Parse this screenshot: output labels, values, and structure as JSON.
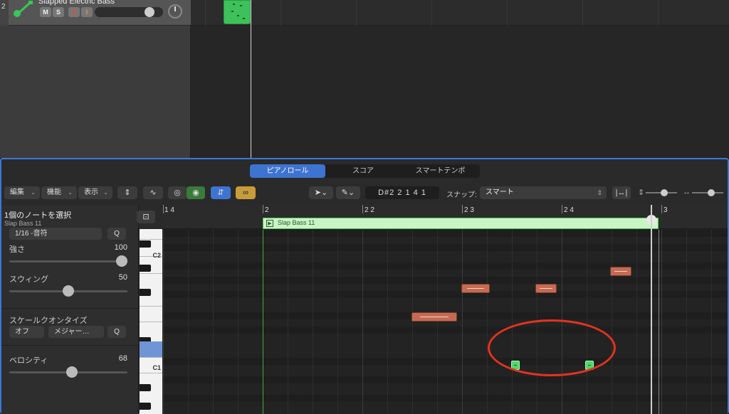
{
  "track": {
    "number": "2",
    "name": "Slapped Electric Bass",
    "buttons": [
      "M",
      "S",
      "R",
      "I"
    ]
  },
  "editor": {
    "tabs": [
      "ピアノロール",
      "スコア",
      "スマートテンポ"
    ],
    "active_tab": "ピアノロール",
    "menus": [
      "編集",
      "機能",
      "表示"
    ],
    "position_display": "D#2  2 1 4 1",
    "snap_label": "スナップ:",
    "snap_value": "スマート"
  },
  "inspector": {
    "title": "1個のノートを選択",
    "subtitle": "Slap Bass 11",
    "quantize_value": "1/16 -音符",
    "quantize_button": "Q",
    "strength_label": "強さ",
    "strength_value": "100",
    "strength_level": 1.0,
    "swing_label": "スウィング",
    "swing_value": "50",
    "swing_level": 0.5,
    "scale_quantize_label": "スケールクオンタイズ",
    "scale_off": "オフ",
    "scale_type": "メジャー…",
    "scale_q": "Q",
    "velocity_label": "ベロシティ",
    "velocity_value": "68",
    "velocity_level": 0.53
  },
  "ruler": {
    "labels": [
      "1 4",
      "2",
      "2 2",
      "2 3",
      "2 4",
      "3"
    ]
  },
  "region": {
    "name": "Slap Bass 11"
  },
  "keys": {
    "labels": [
      "C2",
      "C1"
    ]
  },
  "colors": {
    "accent": "#3d74d1",
    "region": "#3ec15a",
    "note": "#c46b52",
    "selected_note": "#4fd86a",
    "annotation": "#e3331e"
  }
}
